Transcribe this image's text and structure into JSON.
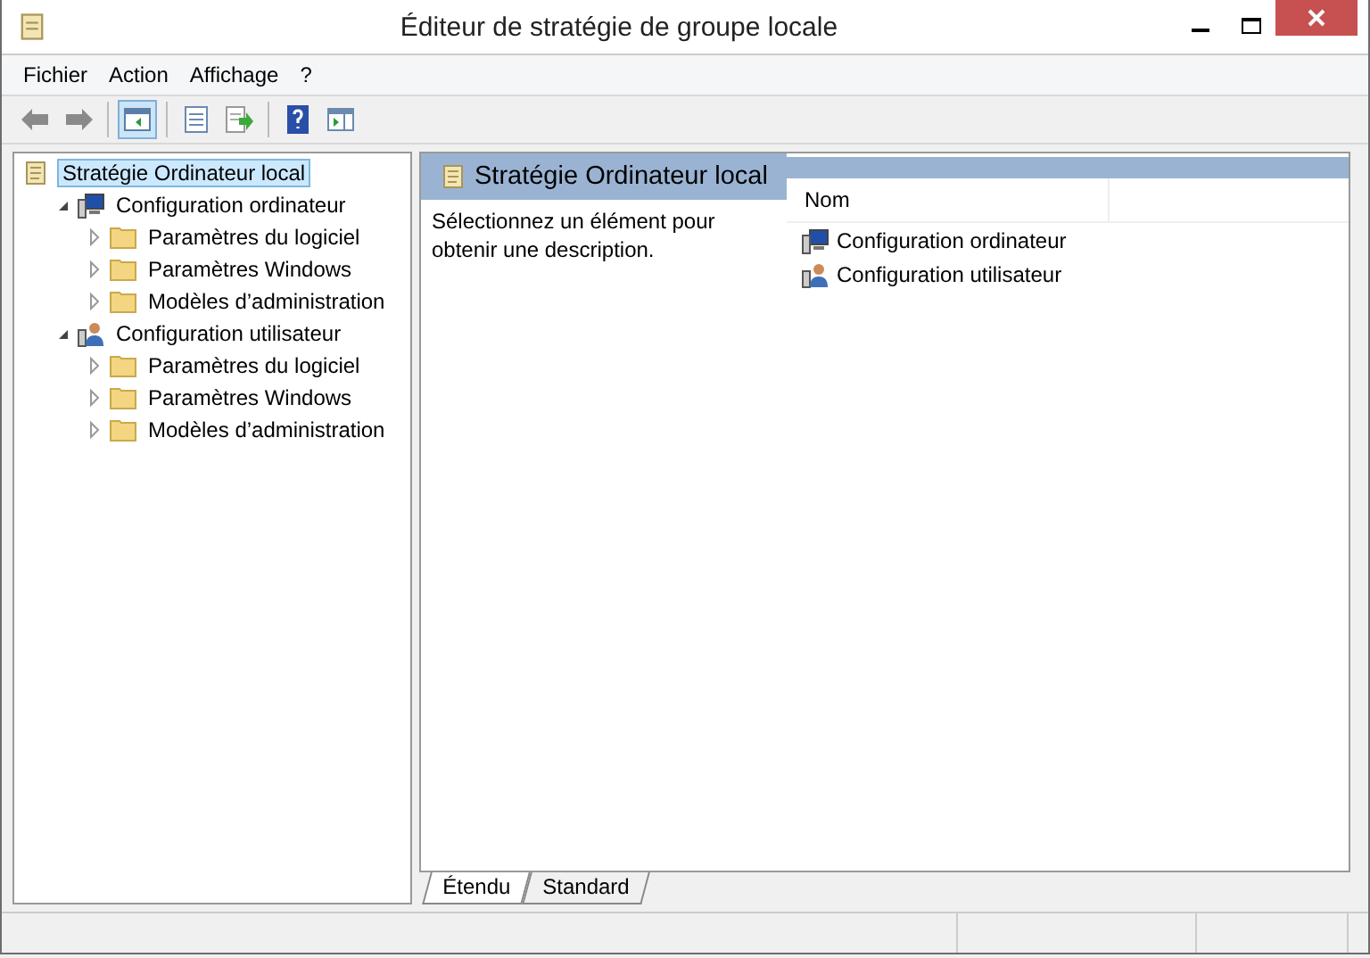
{
  "window": {
    "title": "Éditeur de stratégie de groupe locale"
  },
  "menu": [
    "Fichier",
    "Action",
    "Affichage",
    "?"
  ],
  "toolbar": [
    {
      "kind": "back",
      "pressed": false
    },
    {
      "kind": "forward",
      "pressed": false
    },
    {
      "kind": "sep"
    },
    {
      "kind": "tree",
      "pressed": true
    },
    {
      "kind": "sep"
    },
    {
      "kind": "properties",
      "pressed": false
    },
    {
      "kind": "export",
      "pressed": false
    },
    {
      "kind": "sep"
    },
    {
      "kind": "help",
      "pressed": false
    },
    {
      "kind": "pane",
      "pressed": false
    }
  ],
  "tree": [
    {
      "label": "Stratégie Ordinateur local",
      "kind": "scroll",
      "selected": true,
      "children": [
        {
          "label": "Configuration ordinateur",
          "kind": "computer",
          "selected": false,
          "expanded": true,
          "children": [
            {
              "label": "Paramètres du logiciel",
              "kind": "folder",
              "selected": false,
              "expanded": false
            },
            {
              "label": "Paramètres Windows",
              "kind": "folder",
              "selected": false,
              "expanded": false
            },
            {
              "label": "Modèles d’administration",
              "kind": "folder",
              "selected": false,
              "expanded": false
            }
          ]
        },
        {
          "label": "Configuration utilisateur",
          "kind": "user",
          "selected": false,
          "expanded": true,
          "children": [
            {
              "label": "Paramètres du logiciel",
              "kind": "folder",
              "selected": false,
              "expanded": false
            },
            {
              "label": "Paramètres Windows",
              "kind": "folder",
              "selected": false,
              "expanded": false
            },
            {
              "label": "Modèles d’administration",
              "kind": "folder",
              "selected": false,
              "expanded": false
            }
          ]
        }
      ]
    }
  ],
  "details": {
    "title": "Stratégie Ordinateur local",
    "description": "Sélectionnez un élément pour obtenir une description.",
    "columns": [
      "Nom"
    ],
    "items": [
      {
        "label": "Configuration ordinateur",
        "kind": "computer"
      },
      {
        "label": "Configuration utilisateur",
        "kind": "user"
      }
    ]
  },
  "tabs": [
    {
      "label": "Étendu",
      "selected": true
    },
    {
      "label": "Standard",
      "selected": false
    }
  ]
}
